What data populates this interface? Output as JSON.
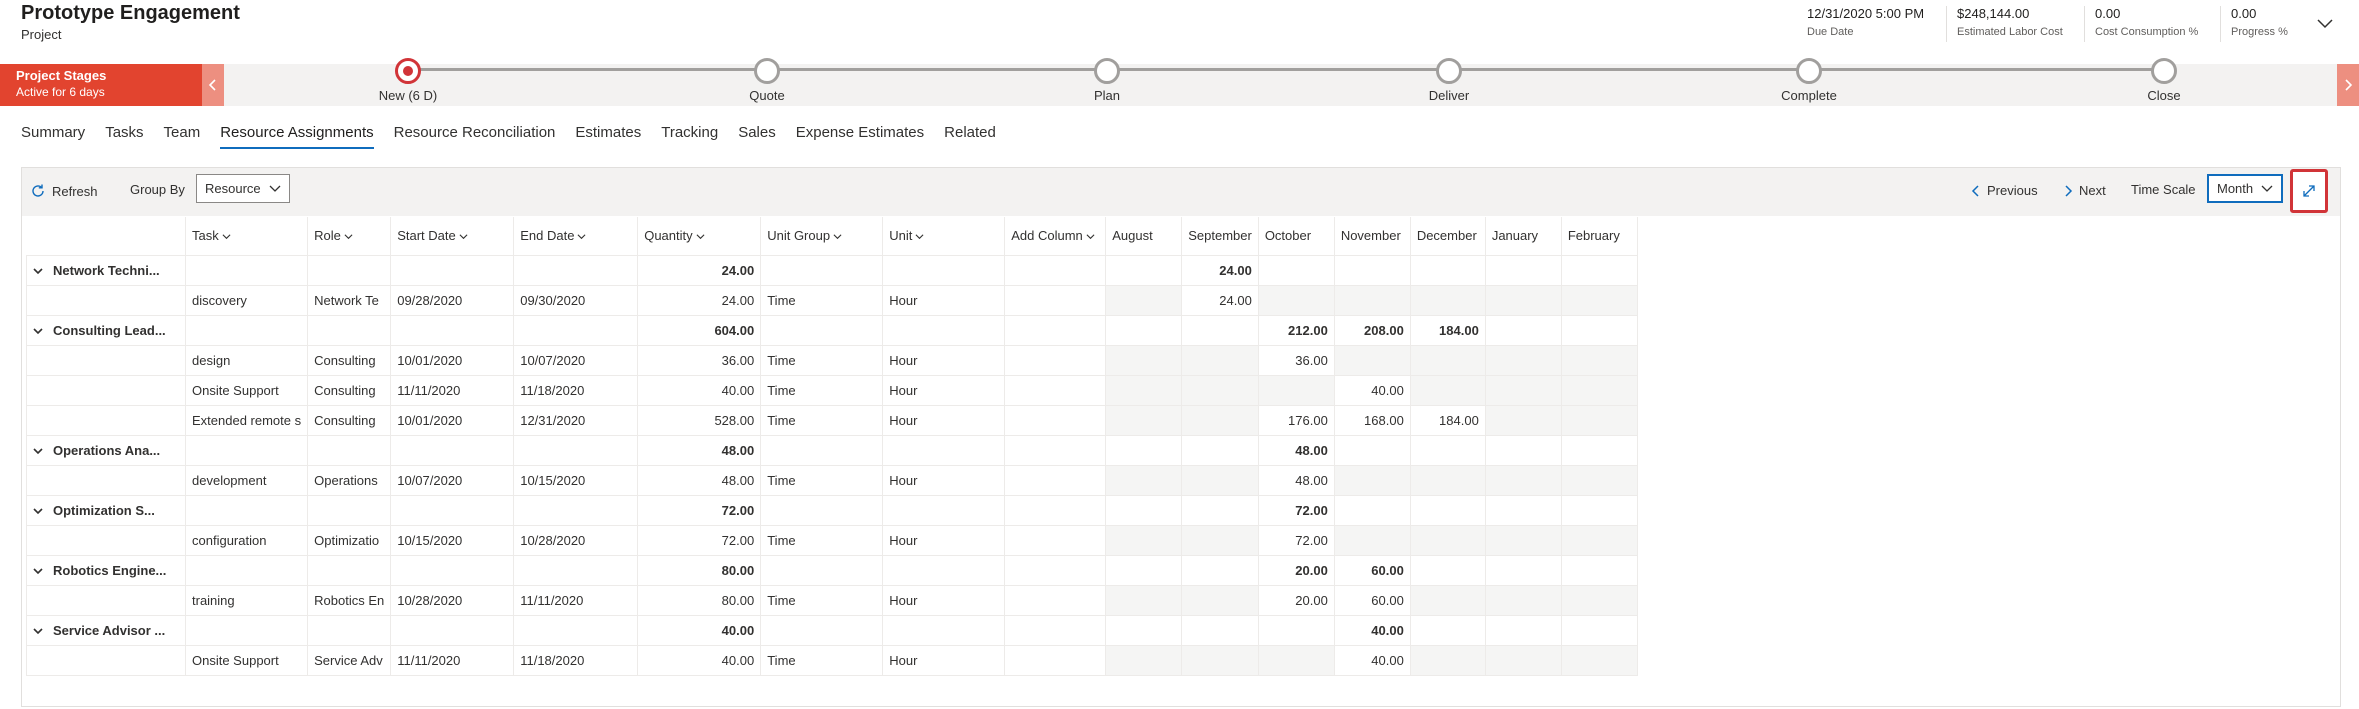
{
  "header": {
    "title": "Prototype Engagement",
    "subtitle": "Project",
    "fields": [
      {
        "value": "12/31/2020 5:00 PM",
        "label": "Due Date"
      },
      {
        "value": "$248,144.00",
        "label": "Estimated Labor Cost"
      },
      {
        "value": "0.00",
        "label": "Cost Consumption %"
      },
      {
        "value": "0.00",
        "label": "Progress %"
      }
    ]
  },
  "stagebar": {
    "active_title": "Project Stages",
    "active_subtitle": "Active for 6 days",
    "stages": [
      "New  (6 D)",
      "Quote",
      "Plan",
      "Deliver",
      "Complete",
      "Close"
    ]
  },
  "tabs": [
    "Summary",
    "Tasks",
    "Team",
    "Resource Assignments",
    "Resource Reconciliation",
    "Estimates",
    "Tracking",
    "Sales",
    "Expense Estimates",
    "Related"
  ],
  "toolbar": {
    "refresh": "Refresh",
    "group_by_label": "Group By",
    "group_by_value": "Resource",
    "previous": "Previous",
    "next": "Next",
    "time_scale_label": "Time Scale",
    "time_scale_value": "Month"
  },
  "grid": {
    "columns": [
      "",
      "Task",
      "Role",
      "Start Date",
      "End Date",
      "Quantity",
      "Unit Group",
      "Unit",
      "Add Column",
      "August",
      "September",
      "October",
      "November",
      "December",
      "January",
      "February"
    ],
    "rows": [
      {
        "group": true,
        "cells": [
          "Network Techni...",
          "",
          "",
          "",
          "",
          "24.00",
          "",
          "",
          "",
          "",
          "24.00",
          "",
          "",
          "",
          "",
          ""
        ]
      },
      {
        "group": false,
        "cells": [
          "",
          "discovery",
          "Network Te",
          "09/28/2020",
          "09/30/2020",
          "24.00",
          "Time",
          "Hour",
          "",
          "",
          "24.00",
          "",
          "",
          "",
          "",
          ""
        ]
      },
      {
        "group": true,
        "cells": [
          "Consulting Lead...",
          "",
          "",
          "",
          "",
          "604.00",
          "",
          "",
          "",
          "",
          "",
          "212.00",
          "208.00",
          "184.00",
          "",
          ""
        ]
      },
      {
        "group": false,
        "cells": [
          "",
          "design",
          "Consulting",
          "10/01/2020",
          "10/07/2020",
          "36.00",
          "Time",
          "Hour",
          "",
          "",
          "",
          "36.00",
          "",
          "",
          "",
          ""
        ]
      },
      {
        "group": false,
        "cells": [
          "",
          "Onsite Support",
          "Consulting",
          "11/11/2020",
          "11/18/2020",
          "40.00",
          "Time",
          "Hour",
          "",
          "",
          "",
          "",
          "40.00",
          "",
          "",
          ""
        ]
      },
      {
        "group": false,
        "cells": [
          "",
          "Extended remote s",
          "Consulting",
          "10/01/2020",
          "12/31/2020",
          "528.00",
          "Time",
          "Hour",
          "",
          "",
          "",
          "176.00",
          "168.00",
          "184.00",
          "",
          ""
        ]
      },
      {
        "group": true,
        "cells": [
          "Operations Ana...",
          "",
          "",
          "",
          "",
          "48.00",
          "",
          "",
          "",
          "",
          "",
          "48.00",
          "",
          "",
          "",
          ""
        ]
      },
      {
        "group": false,
        "cells": [
          "",
          "development",
          "Operations",
          "10/07/2020",
          "10/15/2020",
          "48.00",
          "Time",
          "Hour",
          "",
          "",
          "",
          "48.00",
          "",
          "",
          "",
          ""
        ]
      },
      {
        "group": true,
        "cells": [
          "Optimization S...",
          "",
          "",
          "",
          "",
          "72.00",
          "",
          "",
          "",
          "",
          "",
          "72.00",
          "",
          "",
          "",
          ""
        ]
      },
      {
        "group": false,
        "cells": [
          "",
          "configuration",
          "Optimizatio",
          "10/15/2020",
          "10/28/2020",
          "72.00",
          "Time",
          "Hour",
          "",
          "",
          "",
          "72.00",
          "",
          "",
          "",
          ""
        ]
      },
      {
        "group": true,
        "cells": [
          "Robotics Engine...",
          "",
          "",
          "",
          "",
          "80.00",
          "",
          "",
          "",
          "",
          "",
          "20.00",
          "60.00",
          "",
          "",
          ""
        ]
      },
      {
        "group": false,
        "cells": [
          "",
          "training",
          "Robotics En",
          "10/28/2020",
          "11/11/2020",
          "80.00",
          "Time",
          "Hour",
          "",
          "",
          "",
          "20.00",
          "60.00",
          "",
          "",
          ""
        ]
      },
      {
        "group": true,
        "cells": [
          "Service Advisor ...",
          "",
          "",
          "",
          "",
          "40.00",
          "",
          "",
          "",
          "",
          "",
          "",
          "40.00",
          "",
          "",
          ""
        ]
      },
      {
        "group": false,
        "cells": [
          "",
          "Onsite Support",
          "Service Adv",
          "11/11/2020",
          "11/18/2020",
          "40.00",
          "Time",
          "Hour",
          "",
          "",
          "",
          "",
          "40.00",
          "",
          "",
          ""
        ]
      }
    ]
  },
  "colors": {
    "accent": "#0f6cbd",
    "stage_active": "#e2442f",
    "highlight": "#d13438"
  }
}
